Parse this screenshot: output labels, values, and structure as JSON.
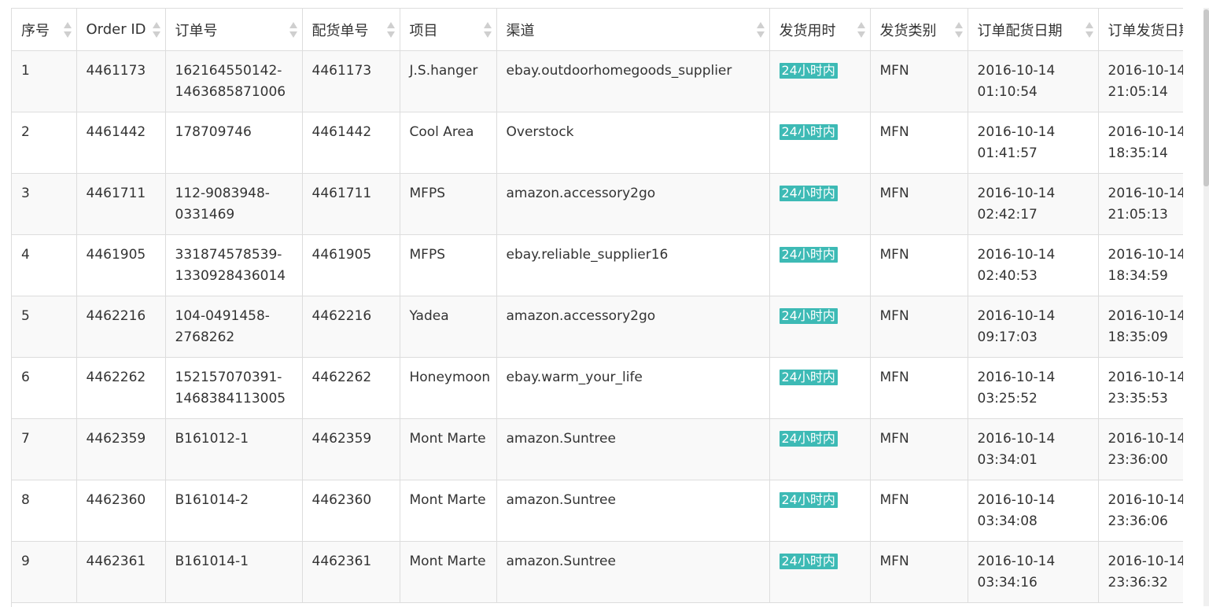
{
  "table": {
    "columns": [
      "序号",
      "Order ID",
      "订单号",
      "配货单号",
      "项目",
      "渠道",
      "发货用时",
      "发货类别",
      "订单配货日期",
      "订单发货日期"
    ],
    "rows": [
      {
        "seq": "1",
        "order_id": "4461173",
        "order_no": "162164550142-1463685871006",
        "pick_no": "4461173",
        "project": "J.S.hanger",
        "channel": "ebay.outdoorhomegoods_supplier",
        "ship_time": "24小时内",
        "ship_type": "MFN",
        "pick_date": "2016-10-14",
        "pick_time": "01:10:54",
        "ship_date": "2016-10-14",
        "ship_clock": "21:05:14"
      },
      {
        "seq": "2",
        "order_id": "4461442",
        "order_no": "178709746",
        "pick_no": "4461442",
        "project": "Cool Area",
        "channel": "Overstock",
        "ship_time": "24小时内",
        "ship_type": "MFN",
        "pick_date": "2016-10-14",
        "pick_time": "01:41:57",
        "ship_date": "2016-10-14",
        "ship_clock": "18:35:14"
      },
      {
        "seq": "3",
        "order_id": "4461711",
        "order_no": "112-9083948-0331469",
        "pick_no": "4461711",
        "project": "MFPS",
        "channel": "amazon.accessory2go",
        "ship_time": "24小时内",
        "ship_type": "MFN",
        "pick_date": "2016-10-14",
        "pick_time": "02:42:17",
        "ship_date": "2016-10-14",
        "ship_clock": "21:05:13"
      },
      {
        "seq": "4",
        "order_id": "4461905",
        "order_no": "331874578539-1330928436014",
        "pick_no": "4461905",
        "project": "MFPS",
        "channel": "ebay.reliable_supplier16",
        "ship_time": "24小时内",
        "ship_type": "MFN",
        "pick_date": "2016-10-14",
        "pick_time": "02:40:53",
        "ship_date": "2016-10-14",
        "ship_clock": "18:34:59"
      },
      {
        "seq": "5",
        "order_id": "4462216",
        "order_no": "104-0491458-2768262",
        "pick_no": "4462216",
        "project": "Yadea",
        "channel": "amazon.accessory2go",
        "ship_time": "24小时内",
        "ship_type": "MFN",
        "pick_date": "2016-10-14",
        "pick_time": "09:17:03",
        "ship_date": "2016-10-14",
        "ship_clock": "18:35:09"
      },
      {
        "seq": "6",
        "order_id": "4462262",
        "order_no": "152157070391-1468384113005",
        "pick_no": "4462262",
        "project": "Honeymoon",
        "channel": "ebay.warm_your_life",
        "ship_time": "24小时内",
        "ship_type": "MFN",
        "pick_date": "2016-10-14",
        "pick_time": "03:25:52",
        "ship_date": "2016-10-14",
        "ship_clock": "23:35:53"
      },
      {
        "seq": "7",
        "order_id": "4462359",
        "order_no": "B161012-1",
        "pick_no": "4462359",
        "project": "Mont Marte",
        "channel": "amazon.Suntree",
        "ship_time": "24小时内",
        "ship_type": "MFN",
        "pick_date": "2016-10-14",
        "pick_time": "03:34:01",
        "ship_date": "2016-10-14",
        "ship_clock": "23:36:00"
      },
      {
        "seq": "8",
        "order_id": "4462360",
        "order_no": "B161014-2",
        "pick_no": "4462360",
        "project": "Mont Marte",
        "channel": "amazon.Suntree",
        "ship_time": "24小时内",
        "ship_type": "MFN",
        "pick_date": "2016-10-14",
        "pick_time": "03:34:08",
        "ship_date": "2016-10-14",
        "ship_clock": "23:36:06"
      },
      {
        "seq": "9",
        "order_id": "4462361",
        "order_no": "B161014-1",
        "pick_no": "4462361",
        "project": "Mont Marte",
        "channel": "amazon.Suntree",
        "ship_time": "24小时内",
        "ship_type": "MFN",
        "pick_date": "2016-10-14",
        "pick_time": "03:34:16",
        "ship_date": "2016-10-14",
        "ship_clock": "23:36:32"
      }
    ]
  },
  "colors": {
    "badge": "#3dbab5",
    "border": "#dddddd",
    "stripe": "#f9f9f9",
    "sort_icon": "#cfcfcf"
  },
  "icons": {
    "sort": "sort-arrows-icon"
  }
}
